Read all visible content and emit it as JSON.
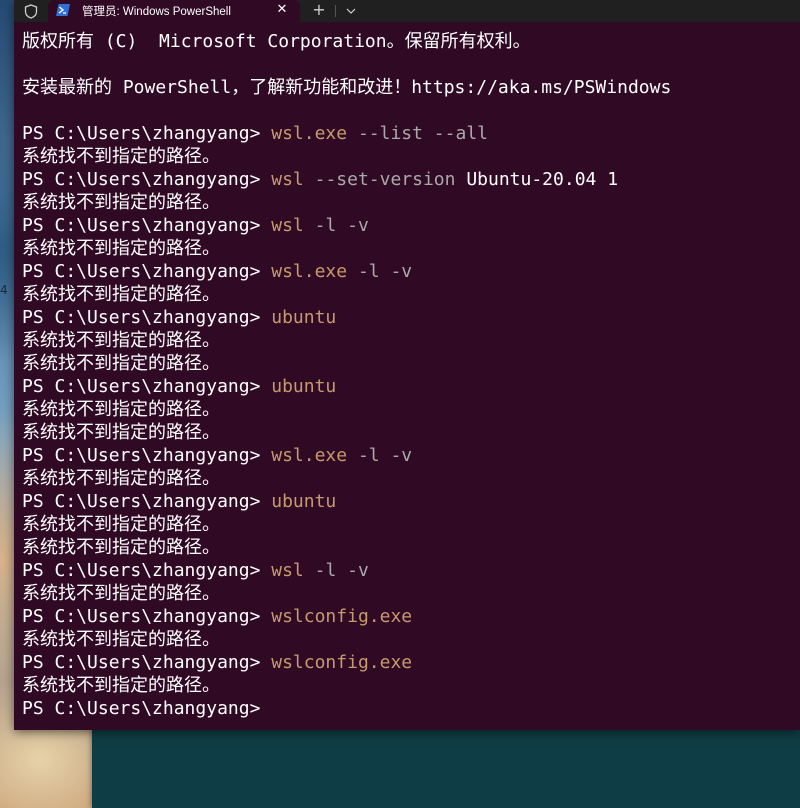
{
  "window": {
    "tab_title": "管理员: Windows PowerShell",
    "close_glyph": "✕",
    "new_tab_glyph": "+",
    "icons": [
      "shield-icon",
      "powershell-icon",
      "close-icon",
      "plus-icon",
      "chevron-down-icon"
    ]
  },
  "colors": {
    "background": "#300a24",
    "titlebar": "#202020",
    "text": "#ffffff",
    "command": "#c79a6d",
    "argument": "#a9a9a9"
  },
  "desktop": {
    "stray_char": "4"
  },
  "terminal": {
    "copyright": "版权所有 (C)  Microsoft Corporation。保留所有权利。",
    "install_notice": "安装最新的 PowerShell，了解新功能和改进！https://aka.ms/PSWindows",
    "prompt": "PS C:\\Users\\zhangyang> ",
    "error": "系统找不到指定的路径。",
    "session": [
      {
        "cmd": "wsl.exe",
        "args": " --list --all",
        "errors": 1
      },
      {
        "cmd": "wsl",
        "args": " --set-version",
        "args2": " Ubuntu-20.04 1",
        "errors": 1
      },
      {
        "cmd": "wsl",
        "args": " -l -v",
        "errors": 1
      },
      {
        "cmd": "wsl.exe",
        "args": " -l -v",
        "errors": 1
      },
      {
        "cmd": "ubuntu",
        "args": "",
        "errors": 2
      },
      {
        "cmd": "ubuntu",
        "args": "",
        "errors": 2
      },
      {
        "cmd": "wsl.exe",
        "args": " -l -v",
        "errors": 1
      },
      {
        "cmd": "ubuntu",
        "args": "",
        "errors": 2
      },
      {
        "cmd": "wsl",
        "args": " -l -v",
        "errors": 1
      },
      {
        "cmd": "wslconfig.exe",
        "args": "",
        "errors": 1
      },
      {
        "cmd": "wslconfig.exe",
        "args": "",
        "errors": 1
      }
    ]
  }
}
